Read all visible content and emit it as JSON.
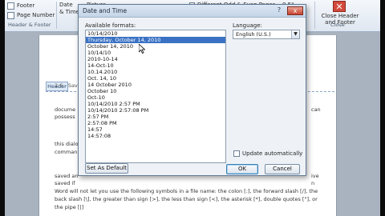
{
  "ribbon": {
    "footer_label": "Footer",
    "page_number_label": "Page Number",
    "header_footer_group": "Header & Footer",
    "date_time_label": "Date\n& Time",
    "picture_label": "Picture",
    "different_odd_even": "Different Odd & Even Pages",
    "margin_value": "0.5\"",
    "close_hf_label": "Close Header\nand Footer",
    "close_group": "Close"
  },
  "document": {
    "header_tab": "Header",
    "header_text": "2.6 - Save",
    "lines": [
      "docume",
      "possess",
      "this dialo",
      "comman",
      "saved an",
      "saved if",
      "Word will not let you use the following symbols in a file name: the colon [:], the forward slash [/], the",
      "back slash [\\], the greater than sign [>], the less than sign [<], the asterisk [*], double quotes [\"], or",
      "the pipe [|]"
    ],
    "right_fragments": [
      "can",
      "ive",
      "n",
      "ive"
    ]
  },
  "dialog": {
    "title": "Date and Time",
    "help_icon": "?",
    "close_icon": "x",
    "available_formats_label": "Available formats:",
    "language_label": "Language:",
    "formats": [
      "10/14/2010",
      "Thursday, October 14, 2010",
      "October 14, 2010",
      "10/14/10",
      "2010-10-14",
      "14-Oct-10",
      "10.14.2010",
      "Oct. 14, 10",
      "14 October 2010",
      "October 10",
      "Oct-10",
      "10/14/2010 2:57 PM",
      "10/14/2010 2:57:08 PM",
      "2:57 PM",
      "2:57:08 PM",
      "14:57",
      "14:57:08"
    ],
    "selected_index": 1,
    "language_value": "English (U.S.)",
    "update_auto_label": "Update automatically",
    "update_auto_checked": false,
    "set_default_label": "Set As Default",
    "ok_label": "OK",
    "cancel_label": "Cancel"
  }
}
